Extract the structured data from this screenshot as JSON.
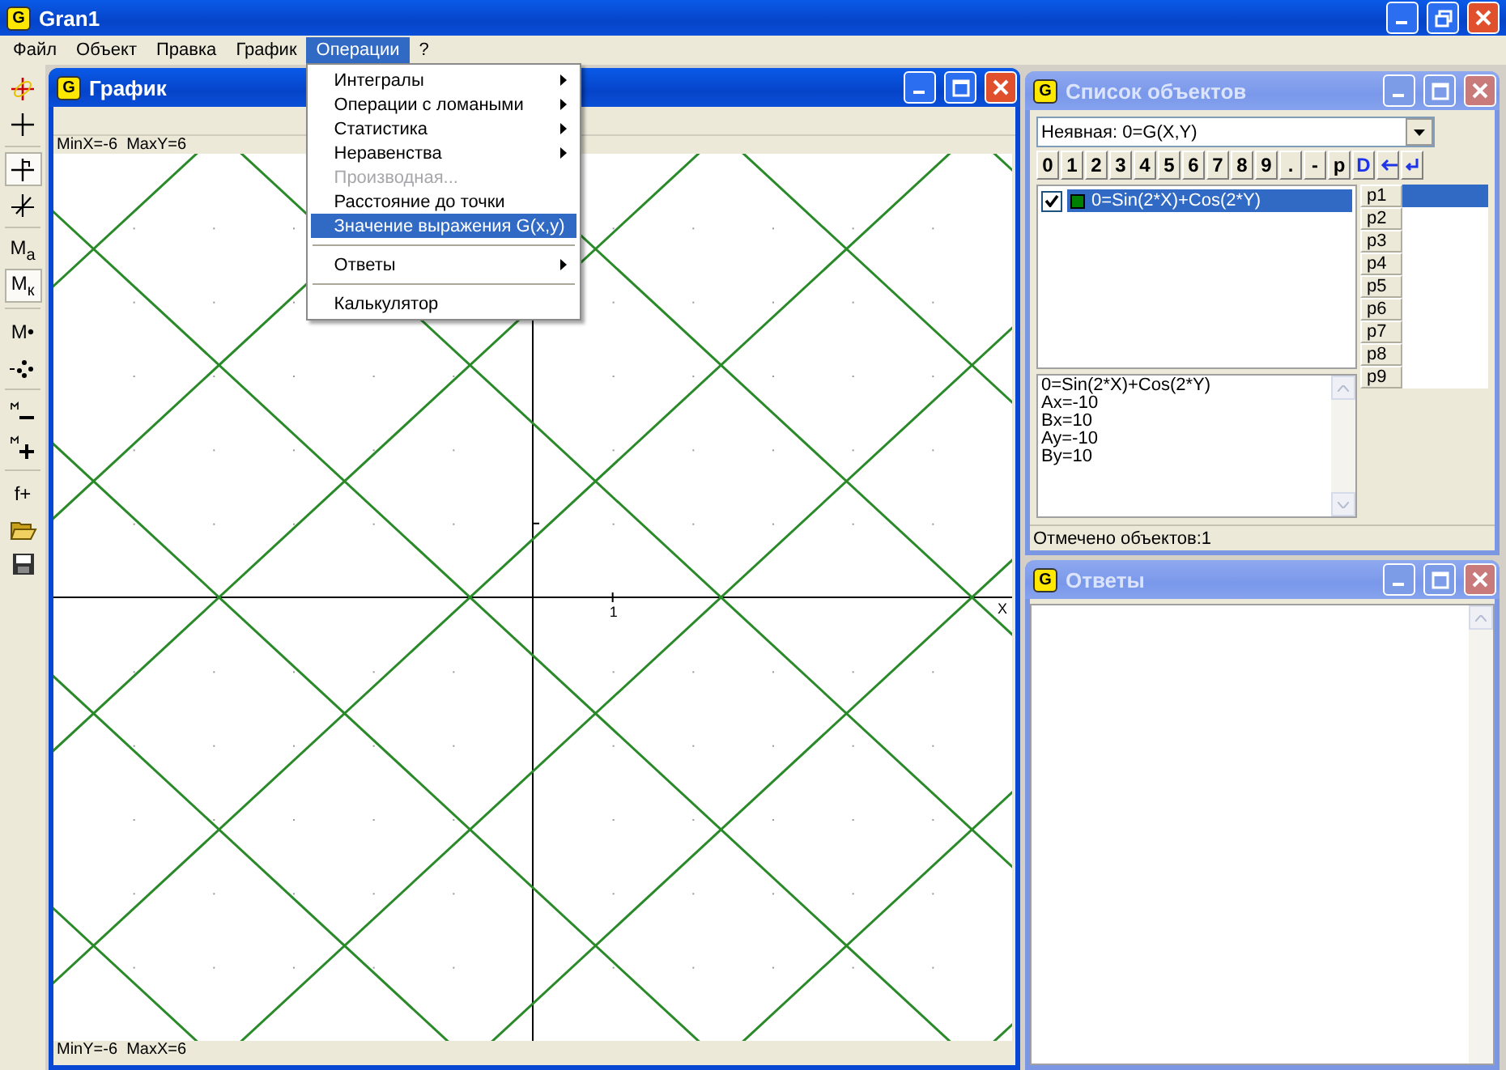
{
  "window": {
    "title": "Gran1",
    "icon_text": "G"
  },
  "menu": [
    {
      "label": "Файл",
      "selected": false
    },
    {
      "label": "Объект",
      "selected": false
    },
    {
      "label": "Правка",
      "selected": false
    },
    {
      "label": "График",
      "selected": false
    },
    {
      "label": "Операции",
      "selected": true
    },
    {
      "label": "?",
      "selected": false
    }
  ],
  "dropdown": [
    {
      "kind": "item",
      "label": "Интегралы",
      "submenu": true,
      "disabled": false,
      "selected": false
    },
    {
      "kind": "item",
      "label": "Операции с ломаными",
      "submenu": true,
      "disabled": false,
      "selected": false
    },
    {
      "kind": "item",
      "label": "Статистика",
      "submenu": true,
      "disabled": false,
      "selected": false
    },
    {
      "kind": "item",
      "label": "Неравенства",
      "submenu": true,
      "disabled": false,
      "selected": false
    },
    {
      "kind": "item",
      "label": "Производная...",
      "submenu": false,
      "disabled": true,
      "selected": false
    },
    {
      "kind": "item",
      "label": "Расстояние до точки",
      "submenu": false,
      "disabled": false,
      "selected": false
    },
    {
      "kind": "item",
      "label": "Значение выражения G(x,y)",
      "submenu": false,
      "disabled": false,
      "selected": true
    },
    {
      "kind": "separator"
    },
    {
      "kind": "item",
      "label": "Ответы",
      "submenu": true,
      "disabled": false,
      "selected": false
    },
    {
      "kind": "separator"
    },
    {
      "kind": "item",
      "label": "Калькулятор",
      "submenu": false,
      "disabled": false,
      "selected": false
    }
  ],
  "toolbar": [
    {
      "kind": "pen",
      "pressed": false
    },
    {
      "kind": "cross",
      "pressed": false
    },
    {
      "kind": "separator"
    },
    {
      "kind": "flag",
      "pressed": true
    },
    {
      "kind": "slant",
      "pressed": false
    },
    {
      "kind": "separator"
    },
    {
      "kind": "text",
      "label": "M$_{a}$",
      "pressed": false
    },
    {
      "kind": "text",
      "label": "M$_{к}$",
      "pressed": true
    },
    {
      "kind": "separator"
    },
    {
      "kind": "text",
      "label": "M•",
      "pressed": false
    },
    {
      "kind": "steps",
      "pressed": false
    },
    {
      "kind": "separator"
    },
    {
      "kind": "mark-minus",
      "pressed": false
    },
    {
      "kind": "mark-plus",
      "pressed": false
    },
    {
      "kind": "separator"
    },
    {
      "kind": "text",
      "label": "f+",
      "pressed": false
    },
    {
      "kind": "open",
      "pressed": false
    },
    {
      "kind": "save",
      "pressed": false
    }
  ],
  "graph": {
    "title": "График",
    "icon_text": "G",
    "active": true,
    "top_info": "MinX=-6  MaxY=6",
    "bottom_info": "MinY=-6  MaxX=6",
    "x_tick": "1",
    "x_axis_label": "X"
  },
  "objects": {
    "title": "Список объектов",
    "icon_text": "G",
    "active": false,
    "combo": "Неявная: 0=G(X,Y)",
    "keys": [
      {
        "kind": "text",
        "label": "0"
      },
      {
        "kind": "text",
        "label": "1"
      },
      {
        "kind": "text",
        "label": "2"
      },
      {
        "kind": "text",
        "label": "3"
      },
      {
        "kind": "text",
        "label": "4"
      },
      {
        "kind": "text",
        "label": "5"
      },
      {
        "kind": "text",
        "label": "6"
      },
      {
        "kind": "text",
        "label": "7"
      },
      {
        "kind": "text",
        "label": "8"
      },
      {
        "kind": "text",
        "label": "9"
      },
      {
        "kind": "text",
        "label": "."
      },
      {
        "kind": "text",
        "label": "-"
      },
      {
        "kind": "text",
        "label": "p"
      },
      {
        "kind": "accent",
        "label": "D"
      },
      {
        "kind": "left-arrow"
      },
      {
        "kind": "enter"
      }
    ],
    "items": [
      {
        "label": "0=Sin(2*X)+Cos(2*Y)",
        "checked": true,
        "selected": true,
        "color": "#008000"
      }
    ],
    "params": [
      {
        "label": "p1",
        "selected": true
      },
      {
        "label": "p2",
        "selected": false
      },
      {
        "label": "p3",
        "selected": false
      },
      {
        "label": "p4",
        "selected": false
      },
      {
        "label": "p5",
        "selected": false
      },
      {
        "label": "p6",
        "selected": false
      },
      {
        "label": "p7",
        "selected": false
      },
      {
        "label": "p8",
        "selected": false
      },
      {
        "label": "p9",
        "selected": false
      }
    ],
    "info": [
      "0=Sin(2*X)+Cos(2*Y)",
      "Ax=-10",
      "Bx=10",
      "Ay=-10",
      "By=10"
    ],
    "status": "Отмечено объектов:1"
  },
  "answers": {
    "title": "Ответы",
    "icon_text": "G",
    "active": false
  }
}
